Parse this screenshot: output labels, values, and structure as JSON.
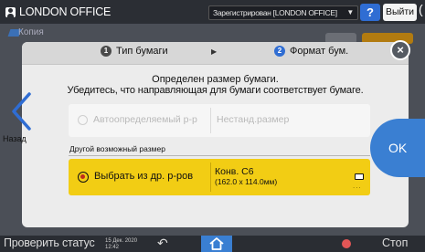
{
  "topbar": {
    "user_name": "LONDON OFFICE",
    "login_status": "Зарегистрирован [LONDON OFFICE]",
    "help_label": "?",
    "logout_label": "Выйти"
  },
  "background_app": {
    "title": "Копия"
  },
  "dialog": {
    "steps": [
      {
        "number": "1",
        "label": "Тип бумаги"
      },
      {
        "number": "2",
        "label": "Формат бум."
      }
    ],
    "message_line1": "Определен размер бумаги.",
    "message_line2": "Убедитесь, что направляющая для бумаги соответствует бумаге.",
    "option_auto": {
      "label": "Автоопределяемый р-р",
      "value": "Нестанд.размер",
      "enabled": false
    },
    "section_label": "Другой возможный размер",
    "option_select": {
      "label": "Выбрать из др. р-ров",
      "value_line1": "Конв. C6",
      "value_line2": "(162.0 x 114.0мм)",
      "selected": true
    },
    "back_label": "Назад",
    "ok_label": "OK"
  },
  "bottombar": {
    "status_label": "Проверить статус",
    "date_line1": "15 Дек. 2020",
    "date_line2": "12:42",
    "stop_label": "Стоп"
  },
  "colors": {
    "selected_option": "#f2cd14",
    "ok_button": "#3a7fd2",
    "step_active": "#2f6dd3"
  }
}
